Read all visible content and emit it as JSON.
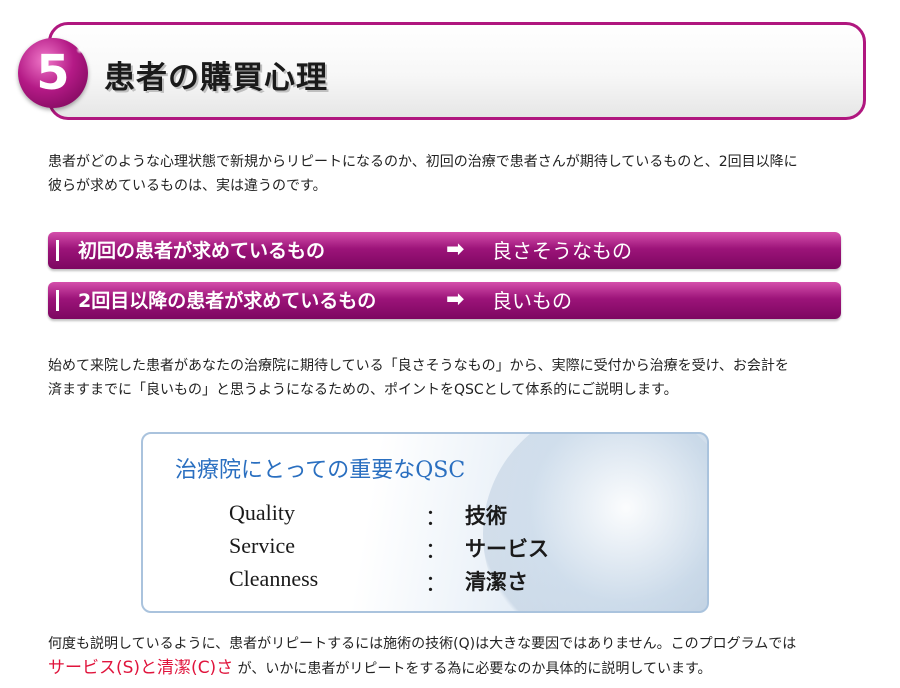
{
  "section": {
    "number": "5",
    "title": "患者の購買心理"
  },
  "intro": {
    "line1": "患者がどのような心理状態で新規からリピートになるのか、初回の治療で患者さんが期待しているものと、2回目以降に",
    "line2": "彼らが求めているものは、実は違うのです。"
  },
  "bars": [
    {
      "label": "初回の患者が求めているもの",
      "arrow": "➡",
      "result": "良さそうなもの"
    },
    {
      "label": "2回目以降の患者が求めているもの",
      "arrow": "➡",
      "result": "良いもの"
    }
  ],
  "middle": {
    "line1": "始めて来院した患者があなたの治療院に期待している「良さそうなもの」から、実際に受付から治療を受け、お会計を",
    "line2": "済ますまでに「良いもの」と思うようになるための、ポイントをQSCとして体系的にご説明します。"
  },
  "qsc": {
    "title": "治療院にとっての重要なQSC",
    "rows": [
      {
        "en": "Quality",
        "colon": "：",
        "jp": "技術"
      },
      {
        "en": "Service",
        "colon": "：",
        "jp": "サービス"
      },
      {
        "en": "Cleanness",
        "colon": "：",
        "jp": "清潔さ"
      }
    ]
  },
  "closing": {
    "line1": "何度も説明しているように、患者がリピートするには施術の技術(Q)は大きな要因ではありません。このプログラムでは",
    "highlight": "サービス(S)と清潔(C)さ",
    "line2_rest": "が、いかに患者がリピートをする為に必要なのか具体的に説明しています。"
  }
}
